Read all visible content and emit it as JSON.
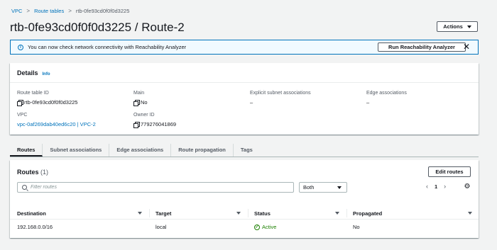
{
  "breadcrumb": {
    "items": [
      "VPC",
      "Route tables"
    ],
    "current": "rtb-0fe93cd0f0f0d3225",
    "separator": ">"
  },
  "page": {
    "title": "rtb-0fe93cd0f0f0d3225 / Route-2",
    "actions_label": "Actions"
  },
  "banner": {
    "text": "You can now check network connectivity with Reachability Analyzer",
    "button_label": "Run Reachability Analyzer",
    "close_glyph": "✕",
    "info_glyph": "i"
  },
  "details": {
    "title": "Details",
    "info_label": "Info",
    "route_table_id_label": "Route table ID",
    "route_table_id": "rtb-0fe93cd0f0f0d3225",
    "main_label": "Main",
    "main_value": "No",
    "explicit_label": "Explicit subnet associations",
    "explicit_value": "–",
    "edge_label": "Edge associations",
    "edge_value": "–",
    "vpc_label": "VPC",
    "vpc_value": "vpc-0af269dab40ed6c20 | VPC-2",
    "owner_label": "Owner ID",
    "owner_value": "779276041869"
  },
  "tabs": [
    "Routes",
    "Subnet associations",
    "Edge associations",
    "Route propagation",
    "Tags"
  ],
  "routes": {
    "title": "Routes",
    "count": "(1)",
    "edit_label": "Edit routes",
    "filter_placeholder": "Filter routes",
    "select_value": "Both",
    "page_number": "1",
    "prev_glyph": "‹",
    "next_glyph": "›",
    "gear_glyph": "⚙",
    "columns": [
      "Destination",
      "Target",
      "Status",
      "Propagated"
    ],
    "rows": [
      {
        "destination": "192.168.0.0/16",
        "target": "local",
        "status": "Active",
        "propagated": "No"
      }
    ],
    "check_glyph": "✓"
  },
  "colors": {
    "link": "#0073bb",
    "success": "#1d8102",
    "banner_bg": "#f1faff"
  }
}
